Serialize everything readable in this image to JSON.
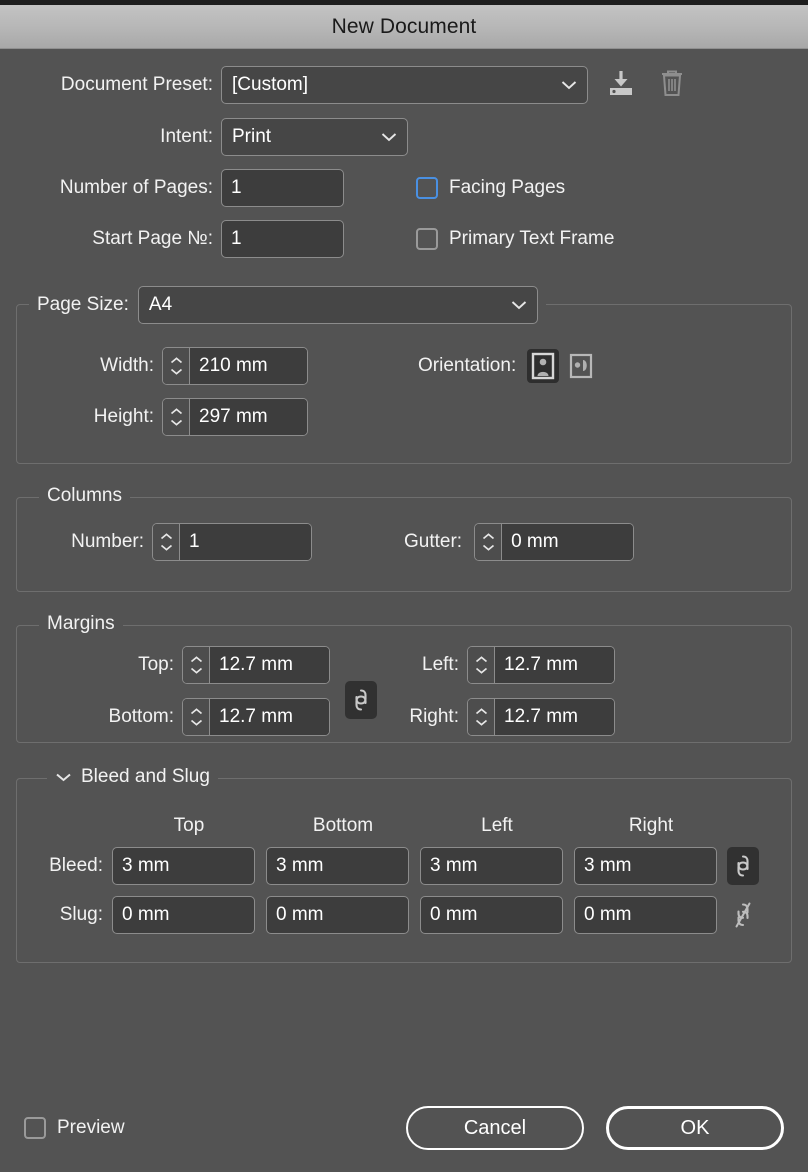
{
  "window": {
    "title": "New Document"
  },
  "preset": {
    "label": "Document Preset:",
    "value": "[Custom]",
    "save_icon": "save-preset-icon",
    "delete_icon": "trash-icon"
  },
  "intent": {
    "label": "Intent:",
    "value": "Print"
  },
  "pages": {
    "number_label": "Number of Pages:",
    "number_value": "1",
    "start_label": "Start Page №:",
    "start_value": "1",
    "facing_pages_label": "Facing Pages",
    "facing_pages_checked": false,
    "primary_text_frame_label": "Primary Text Frame",
    "primary_text_frame_checked": false
  },
  "page_size": {
    "legend": "Page Size:",
    "value": "A4",
    "width_label": "Width:",
    "width_value": "210 mm",
    "height_label": "Height:",
    "height_value": "297 mm",
    "orientation_label": "Orientation:",
    "orientation_selected": "portrait"
  },
  "columns": {
    "legend": "Columns",
    "number_label": "Number:",
    "number_value": "1",
    "gutter_label": "Gutter:",
    "gutter_value": "0 mm"
  },
  "margins": {
    "legend": "Margins",
    "top_label": "Top:",
    "top_value": "12.7 mm",
    "bottom_label": "Bottom:",
    "bottom_value": "12.7 mm",
    "left_label": "Left:",
    "left_value": "12.7 mm",
    "right_label": "Right:",
    "right_value": "12.7 mm",
    "link_state": "linked"
  },
  "bleed_slug": {
    "legend": "Bleed and Slug",
    "expanded": true,
    "columns": [
      "Top",
      "Bottom",
      "Left",
      "Right"
    ],
    "bleed_label": "Bleed:",
    "bleed_values": [
      "3 mm",
      "3 mm",
      "3 mm",
      "3 mm"
    ],
    "bleed_link_state": "linked",
    "slug_label": "Slug:",
    "slug_values": [
      "0 mm",
      "0 mm",
      "0 mm",
      "0 mm"
    ],
    "slug_link_state": "broken"
  },
  "footer": {
    "preview_label": "Preview",
    "preview_checked": false,
    "cancel_label": "Cancel",
    "ok_label": "OK"
  },
  "colors": {
    "dialog_bg": "#535353",
    "field_bg": "#3d3d3d",
    "border": "#8c8c8c",
    "group_border": "#6e6e6e",
    "accent_blue": "#4a90e2",
    "titlebar": "#b6b6b6"
  }
}
